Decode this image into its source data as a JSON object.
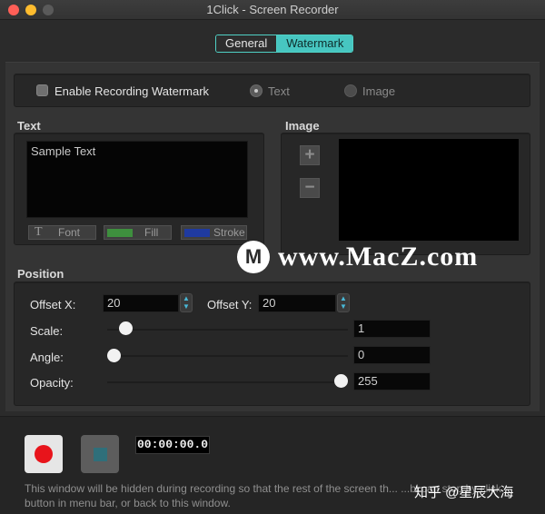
{
  "window": {
    "title": "1Click - Screen Recorder"
  },
  "tabs": [
    {
      "label": "General",
      "active": false
    },
    {
      "label": "Watermark",
      "active": true
    }
  ],
  "watermark_toggle": {
    "enable_label": "Enable Recording Watermark",
    "enabled": false,
    "type_options": [
      {
        "label": "Text",
        "selected": true
      },
      {
        "label": "Image",
        "selected": false
      }
    ]
  },
  "text_section": {
    "title": "Text",
    "sample_text": "Sample Text",
    "buttons": {
      "font": "Font",
      "fill": "Fill",
      "stroke": "Stroke"
    },
    "fill_color": "#3e8f3e",
    "stroke_color": "#1f3aa0"
  },
  "image_section": {
    "title": "Image",
    "add_label": "+",
    "remove_label": "−"
  },
  "position_section": {
    "title": "Position",
    "offset_x_label": "Offset X:",
    "offset_x": "20",
    "offset_y_label": "Offset Y:",
    "offset_y": "20",
    "scale_label": "Scale:",
    "scale": "1",
    "scale_level": 0.05,
    "angle_label": "Angle:",
    "angle": "0",
    "angle_level": 0.0,
    "opacity_label": "Opacity:",
    "opacity": "255",
    "opacity_level": 1.0
  },
  "recorder": {
    "timer": "00:00:00.0",
    "hint": "This window will be hidden during recording so that the rest of the screen th... ...bl can stop by click button in menu bar, or back to this window."
  },
  "overlay": {
    "watermark_logo_letter": "M",
    "watermark_text": "www.MacZ.com",
    "source_credit": "知乎 @星辰大海"
  },
  "colors": {
    "accent": "#47c6c1",
    "record": "#e8141b"
  }
}
